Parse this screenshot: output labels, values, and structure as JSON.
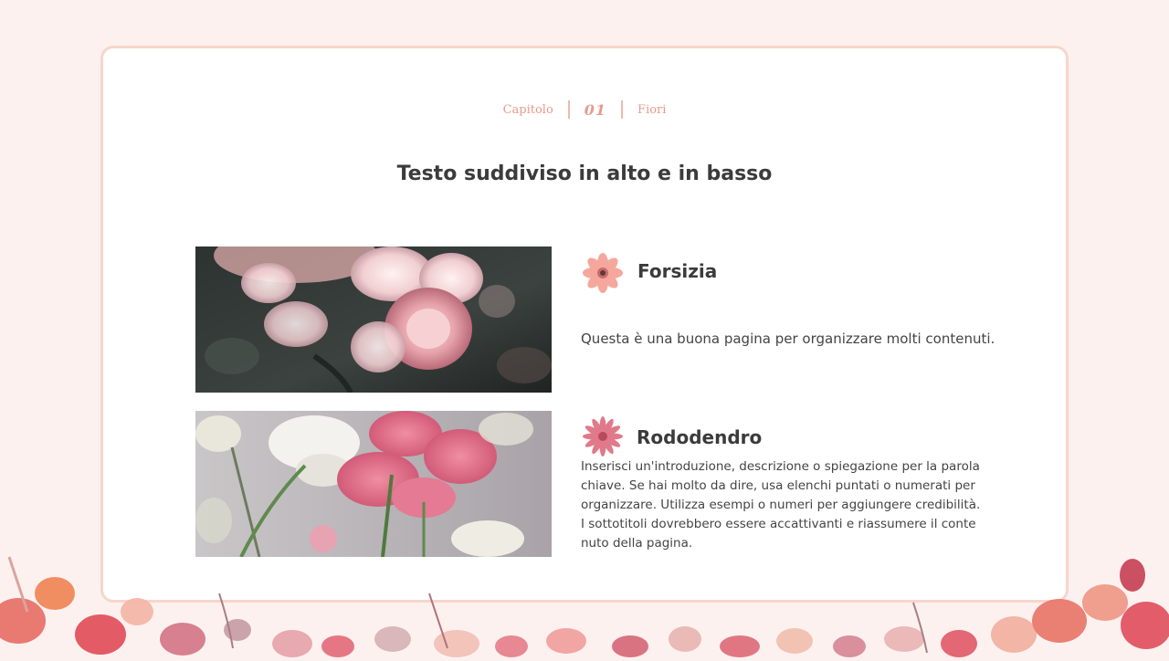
{
  "header": {
    "chapter_label": "Capitolo",
    "chapter_number": "01",
    "section_label": "Fiori"
  },
  "page_title": "Testo suddiviso in alto e in basso",
  "items": [
    {
      "heading": "Forsizia",
      "description": "Questa è una buona pagina per organizzare molti contenuti.",
      "icon": "pink-flower-icon"
    },
    {
      "heading": "Rododendro",
      "description": "Inserisci un'introduzione, descrizione o spiegazione per la parola chiave. Se hai molto da dire, usa elenchi puntati o numerati per organizzare. Utilizza esempi o numeri per aggiungere credibilità. I sottotitoli dovrebbero essere accattivanti e riassumere il contenuto della pagina.",
      "icon": "pink-flower-icon"
    }
  ],
  "colors": {
    "accent": "#e79a8f",
    "border": "#f6d6cc",
    "background": "#fdf1f0",
    "text": "#3b3b3b"
  }
}
